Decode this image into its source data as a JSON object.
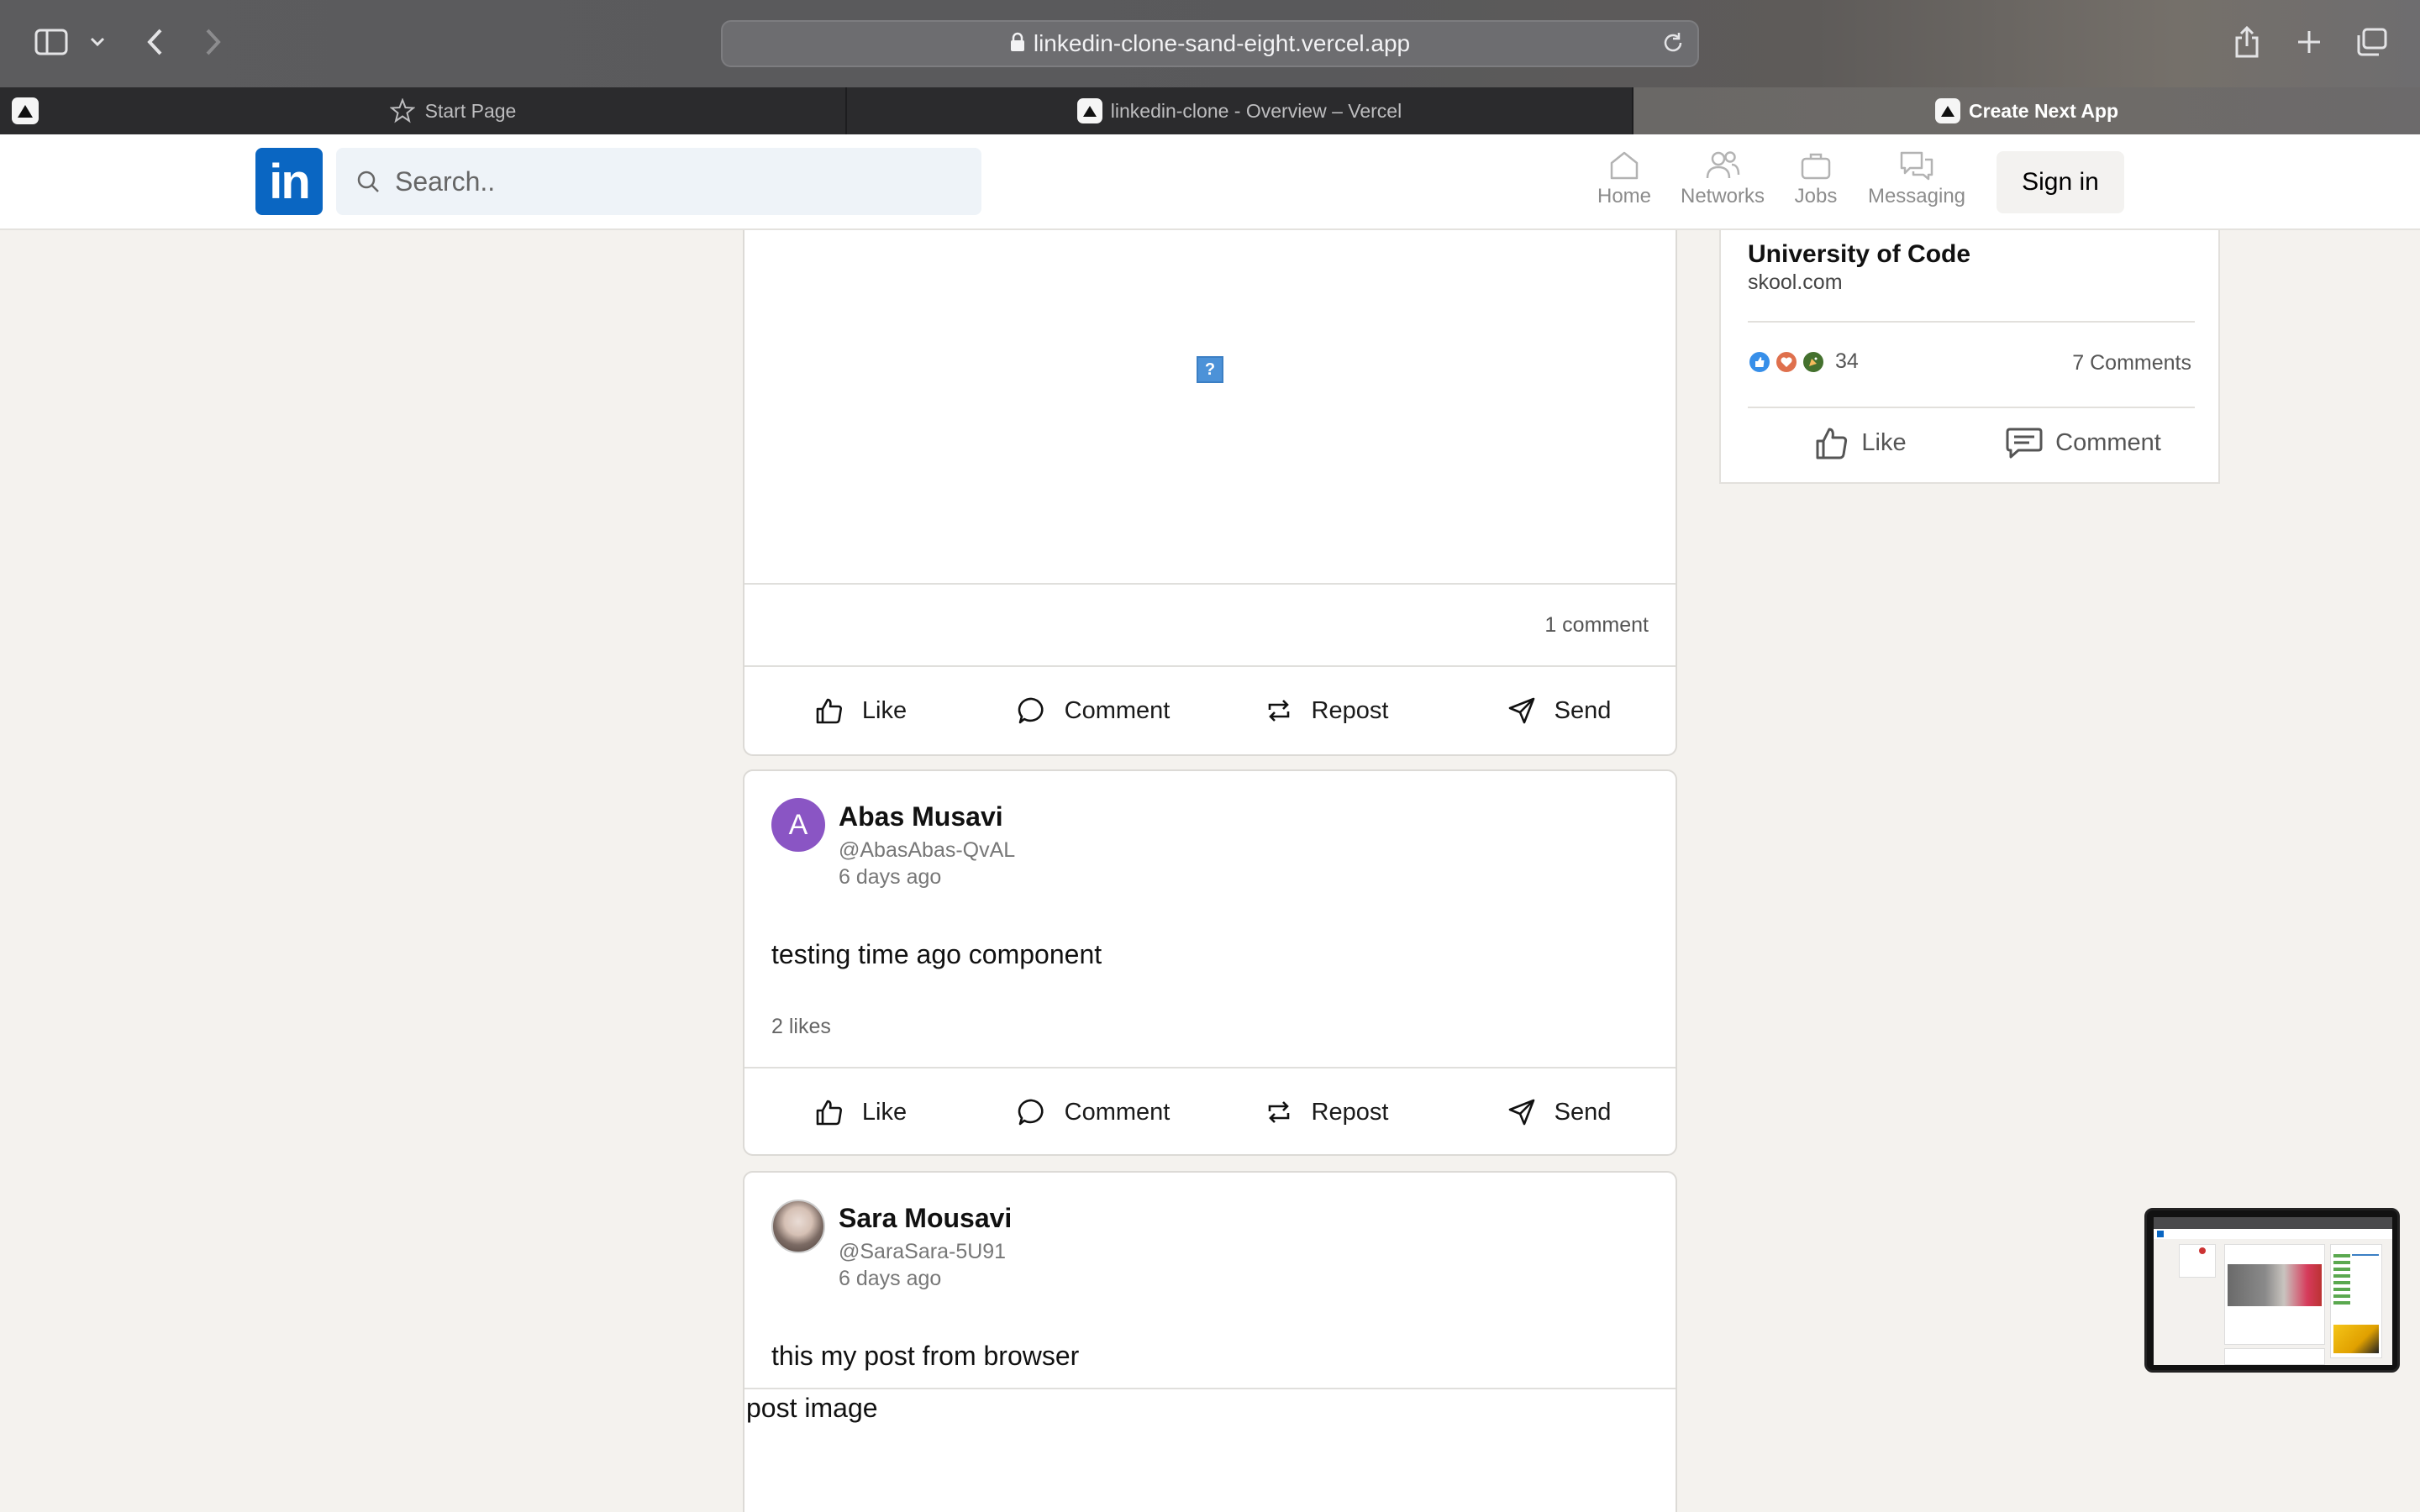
{
  "browser": {
    "url": "linkedin-clone-sand-eight.vercel.app",
    "tabs": [
      {
        "label": "Start Page",
        "icon": "star-icon",
        "active": false
      },
      {
        "label": "linkedin-clone - Overview – Vercel",
        "icon": "vercel-icon",
        "active": false
      },
      {
        "label": "Create Next App",
        "icon": "vercel-icon",
        "active": true
      }
    ]
  },
  "header": {
    "logo": "in",
    "search_placeholder": "Search..",
    "nav": [
      {
        "label": "Home",
        "icon": "home-icon"
      },
      {
        "label": "Networks",
        "icon": "networks-icon"
      },
      {
        "label": "Jobs",
        "icon": "jobs-icon"
      },
      {
        "label": "Messaging",
        "icon": "messaging-icon"
      }
    ],
    "signin_label": "Sign in"
  },
  "feed": {
    "top_post": {
      "broken_image_glyph": "?",
      "comment_count": "1 comment"
    },
    "actions": {
      "like": "Like",
      "comment": "Comment",
      "repost": "Repost",
      "send": "Send"
    },
    "posts": [
      {
        "avatar_letter": "A",
        "author": "Abas Musavi",
        "handle": "@AbasAbas-QvAL",
        "time": "6 days ago",
        "text": "testing time ago component",
        "likes": "2 likes"
      },
      {
        "author": "Sara Mousavi",
        "handle": "@SaraSara-5U91",
        "time": "6 days ago",
        "text": "this my post from browser",
        "image_alt": "post image"
      }
    ]
  },
  "sidebar": {
    "title": "University of Code",
    "subtitle": "skool.com",
    "reaction_count": "34",
    "comments": "7 Comments",
    "like_label": "Like",
    "comment_label": "Comment"
  },
  "colors": {
    "brand": "#0a66c2",
    "background": "#f4f2ee",
    "avatar_purple": "#8a55c4"
  }
}
